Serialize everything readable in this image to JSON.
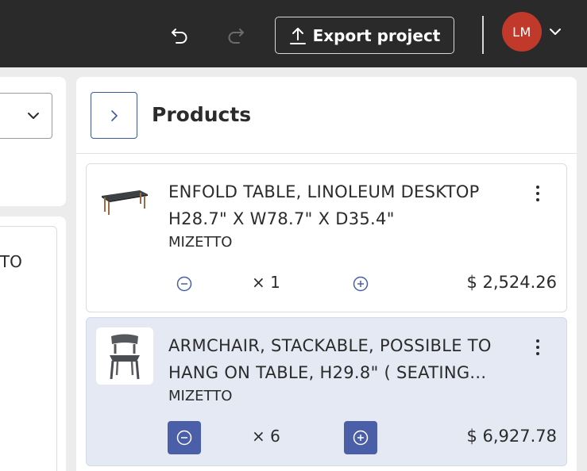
{
  "header": {
    "export_label": "Export project",
    "avatar_initials": "LM",
    "icons": [
      "undo-icon",
      "redo-icon",
      "upload-icon",
      "chevron-down-icon"
    ]
  },
  "left": {
    "partial_text": "TTO"
  },
  "products": {
    "title": "Products",
    "items": [
      {
        "name": "ENFOLD TABLE, LINOLEUM DESKTOP H28.7\" X W78.7\" X D35.4\"",
        "brand": "MIZETTO",
        "quantity": "× 1",
        "price": "$ 2,524.26"
      },
      {
        "name": "ARMCHAIR, STACKABLE, POSSIBLE TO HANG ON TABLE, H29.8\" ( SEATING...",
        "brand": "MIZETTO",
        "quantity": "× 6",
        "price": "$ 6,927.78"
      }
    ]
  },
  "colors": {
    "topbar": "#2a2a2a",
    "accent": "#4b5ea8",
    "avatar": "#c0392b",
    "selected_item_bg": "#e4e9f3"
  }
}
